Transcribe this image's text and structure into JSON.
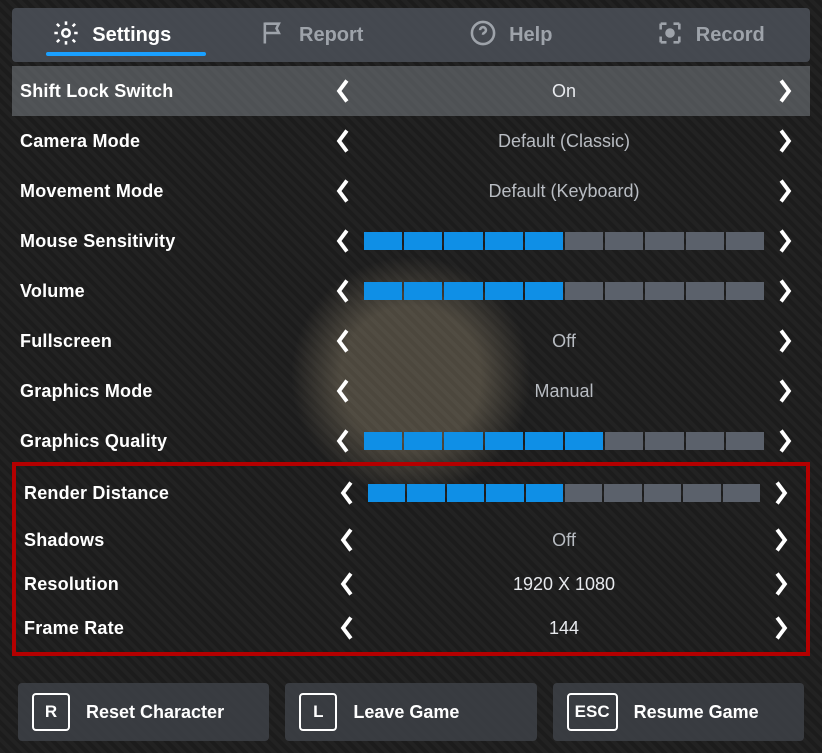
{
  "tabs": {
    "settings": "Settings",
    "report": "Report",
    "help": "Help",
    "record": "Record"
  },
  "rows": {
    "shiftlock": {
      "label": "Shift Lock Switch",
      "value": "On"
    },
    "camera": {
      "label": "Camera Mode",
      "value": "Default (Classic)"
    },
    "movement": {
      "label": "Movement Mode",
      "value": "Default (Keyboard)"
    },
    "mouse": {
      "label": "Mouse Sensitivity",
      "filled": 5,
      "total": 10
    },
    "volume": {
      "label": "Volume",
      "filled": 5,
      "total": 10
    },
    "fullscreen": {
      "label": "Fullscreen",
      "value": "Off"
    },
    "graphicsmode": {
      "label": "Graphics Mode",
      "value": "Manual"
    },
    "graphicsquality": {
      "label": "Graphics Quality",
      "filled": 6,
      "total": 10
    },
    "renderdist": {
      "label": "Render Distance",
      "filled": 5,
      "total": 10
    },
    "shadows": {
      "label": "Shadows",
      "value": "Off"
    },
    "resolution": {
      "label": "Resolution",
      "value": "1920 X 1080"
    },
    "framerate": {
      "label": "Frame Rate",
      "value": "144"
    }
  },
  "footer": {
    "reset": {
      "key": "R",
      "label": "Reset Character"
    },
    "leave": {
      "key": "L",
      "label": "Leave Game"
    },
    "resume": {
      "key": "ESC",
      "label": "Resume Game"
    }
  }
}
